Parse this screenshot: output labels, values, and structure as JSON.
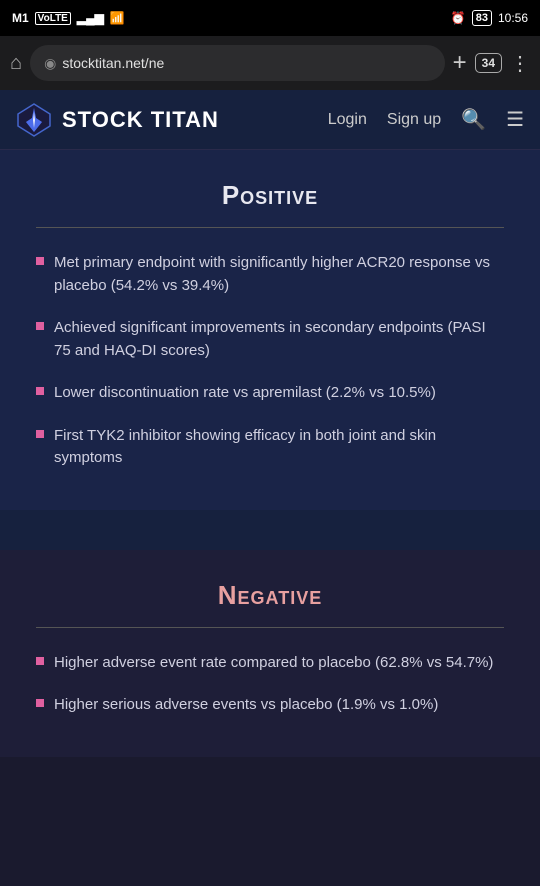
{
  "statusBar": {
    "carrier": "M1",
    "carrierType": "VoLTE",
    "time": "10:56",
    "batteryLevel": "83"
  },
  "browserBar": {
    "url": "stocktitan.net/ne",
    "tabCount": "34",
    "addTabLabel": "+",
    "moreLabel": "⋮",
    "homeLabel": "⌂"
  },
  "nav": {
    "logoText": "STOCK TITAN",
    "loginLabel": "Login",
    "signupLabel": "Sign up"
  },
  "positive": {
    "title": "Positive",
    "bullets": [
      "Met primary endpoint with significantly higher ACR20 response vs placebo (54.2% vs 39.4%)",
      "Achieved significant improvements in secondary endpoints (PASI 75 and HAQ-DI scores)",
      "Lower discontinuation rate vs apremilast (2.2% vs 10.5%)",
      "First TYK2 inhibitor showing efficacy in both joint and skin symptoms"
    ]
  },
  "negative": {
    "title": "Negative",
    "bullets": [
      "Higher adverse event rate compared to placebo (62.8% vs 54.7%)",
      "Higher serious adverse events vs placebo (1.9% vs 1.0%)"
    ]
  }
}
